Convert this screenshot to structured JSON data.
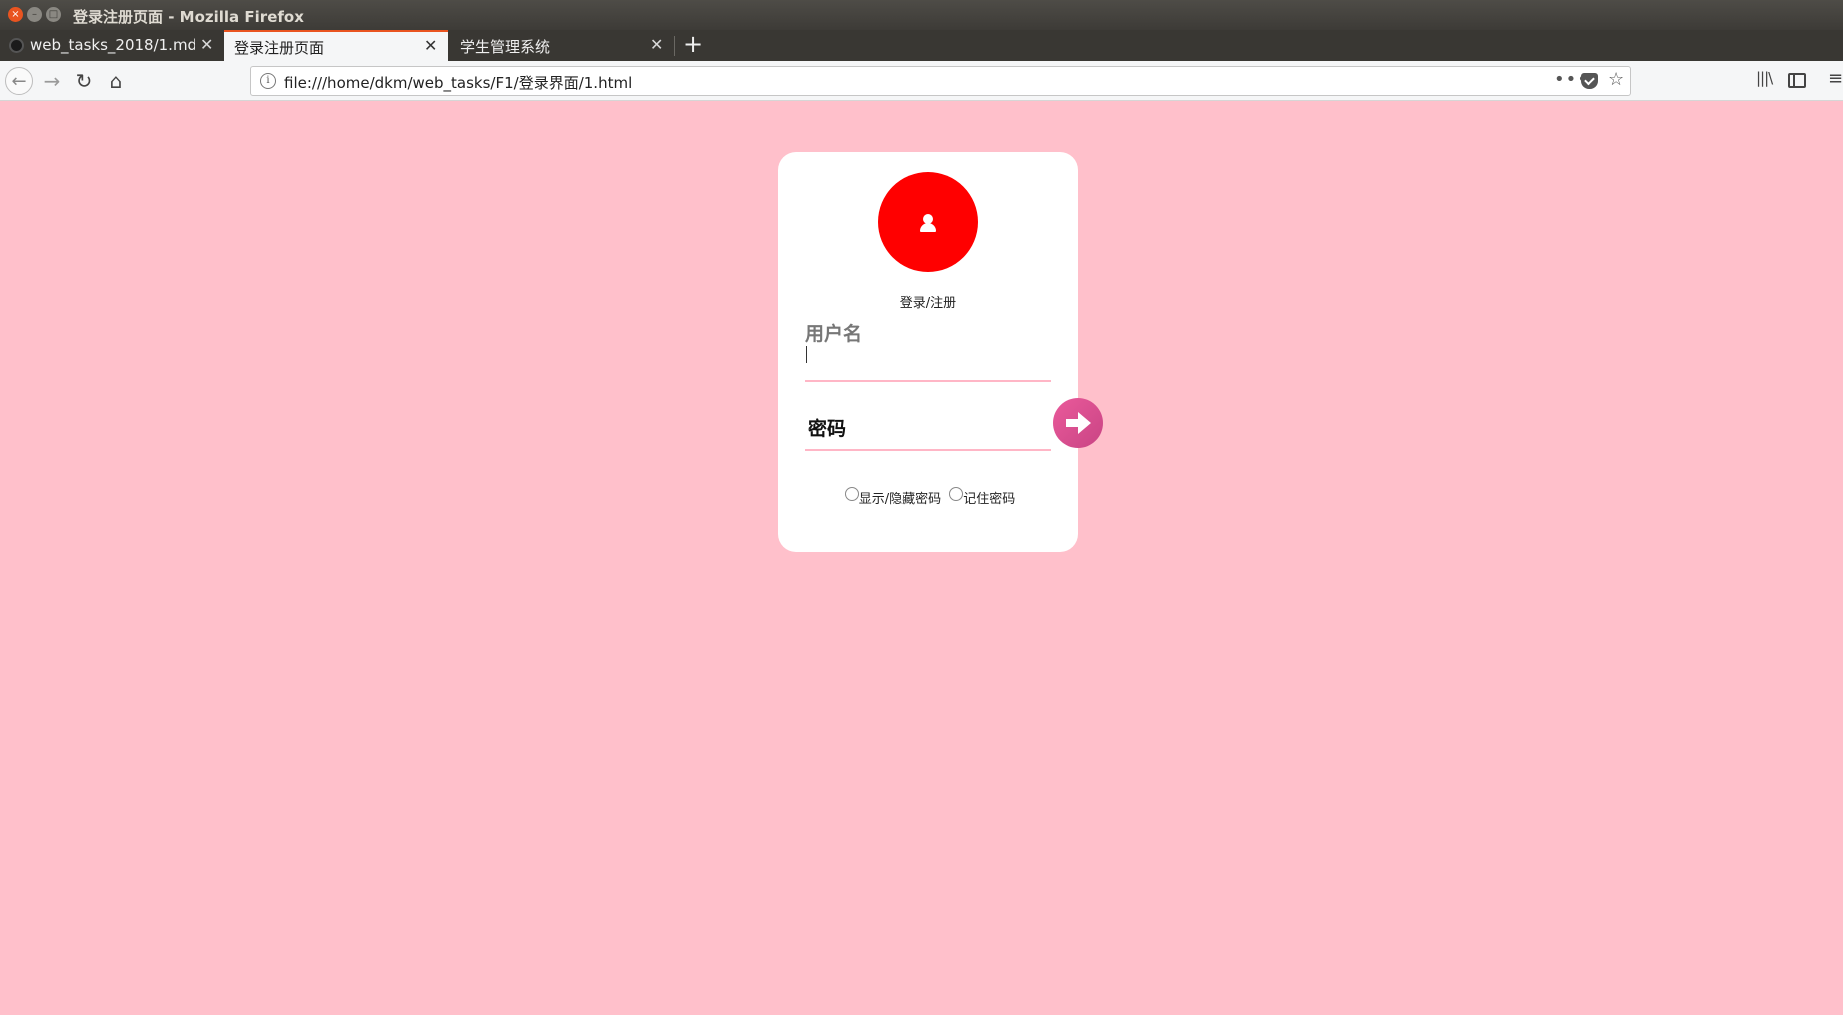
{
  "window": {
    "title": "登录注册页面 - Mozilla Firefox",
    "controls": {
      "close": "×",
      "minimize": "–",
      "maximize": "□"
    }
  },
  "tabs": [
    {
      "label": "web_tasks_2018/1.md at",
      "close": "✕",
      "active": false,
      "icon": "github-icon"
    },
    {
      "label": "登录注册页面",
      "close": "✕",
      "active": true
    },
    {
      "label": "学生管理系统",
      "close": "✕",
      "active": false
    }
  ],
  "tabstrip": {
    "new_tab": "+"
  },
  "toolbar": {
    "back": "←",
    "forward": "→",
    "reload": "↻",
    "home": "⌂",
    "url_info": "i",
    "url": "file:///home/dkm/web_tasks/F1/登录界面/1.html",
    "page_actions": "•••",
    "bookmark": "☆",
    "library": "|||\\",
    "menu": "≡"
  },
  "login": {
    "heading": "登录/注册",
    "username_label": "用户名",
    "password_label": "密码",
    "show_password_label": "显示/隐藏密码",
    "remember_label": "记住密码"
  },
  "colors": {
    "page_background": "#ffc0cb",
    "avatar": "#ff0000",
    "submit_button": "#e0518f",
    "input_underline": "#ffb6c6",
    "tab_accent": "#e95420"
  }
}
